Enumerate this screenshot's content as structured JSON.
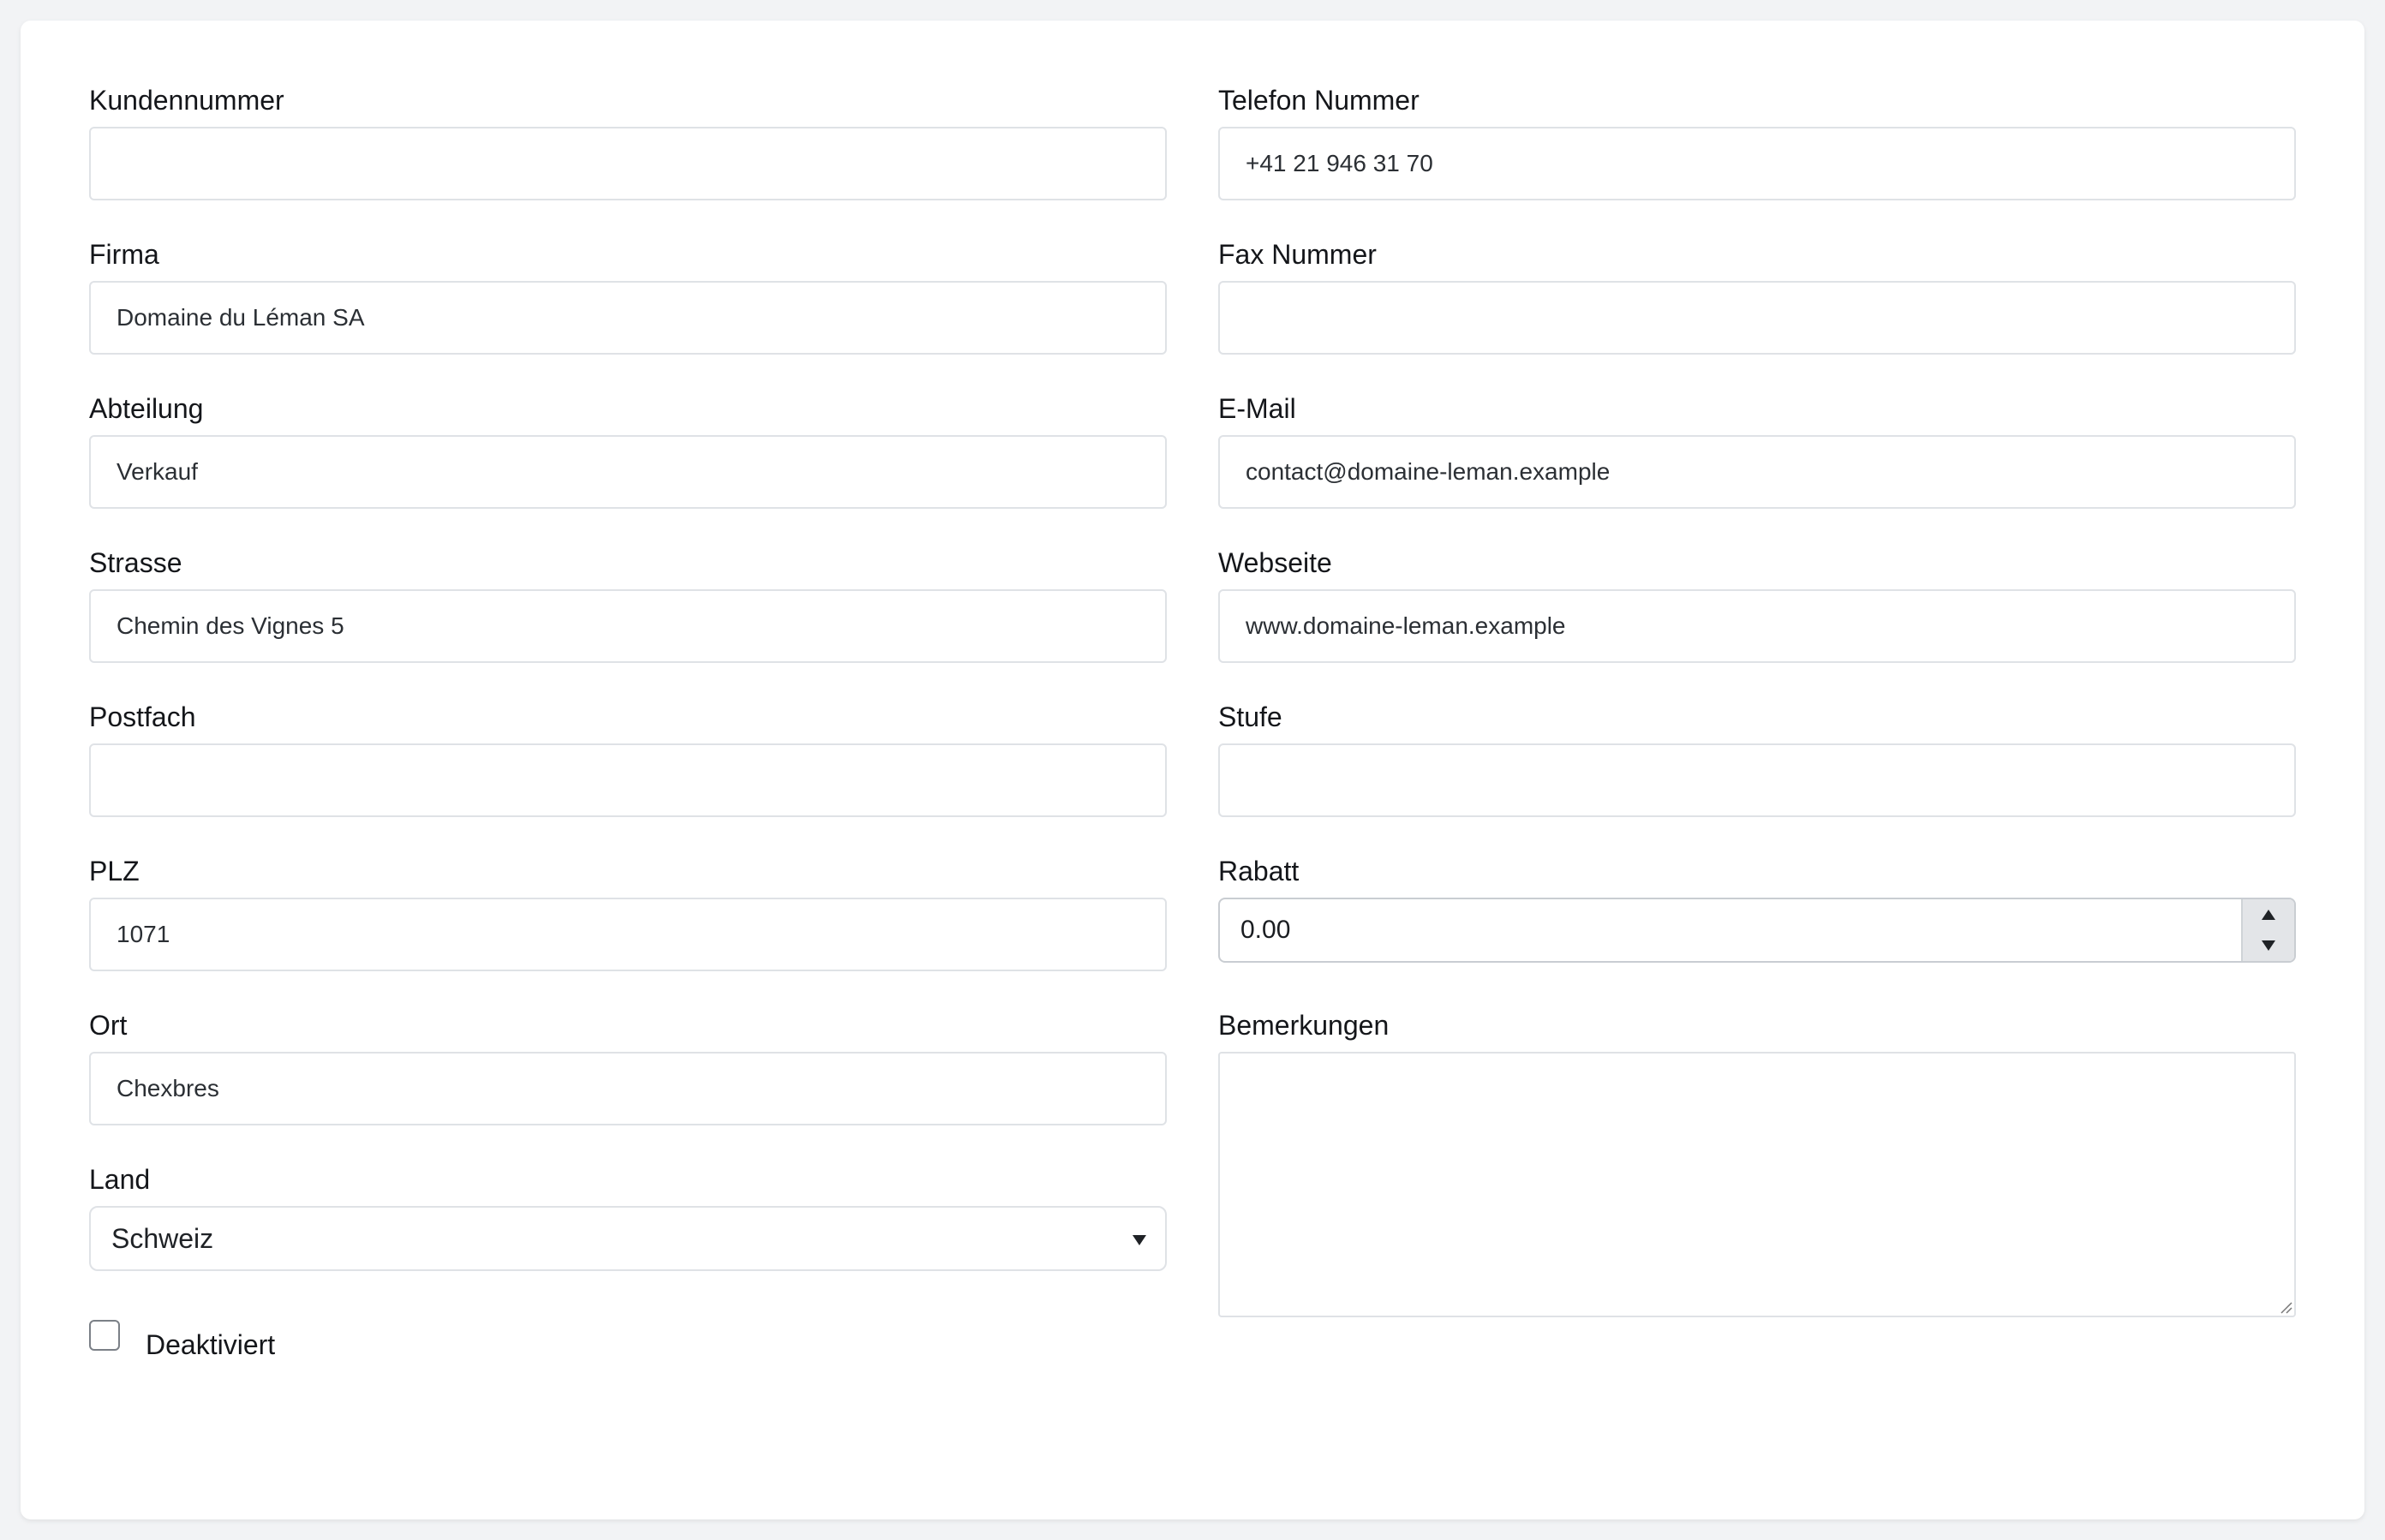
{
  "form": {
    "left": {
      "kundennummer": {
        "label": "Kundennummer",
        "value": ""
      },
      "firma": {
        "label": "Firma",
        "value": "Domaine du Léman SA"
      },
      "abteilung": {
        "label": "Abteilung",
        "value": "Verkauf"
      },
      "strasse": {
        "label": "Strasse",
        "value": "Chemin des Vignes 5"
      },
      "postfach": {
        "label": "Postfach",
        "value": ""
      },
      "plz": {
        "label": "PLZ",
        "value": "1071"
      },
      "ort": {
        "label": "Ort",
        "value": "Chexbres"
      },
      "land": {
        "label": "Land",
        "value": "Schweiz"
      },
      "deaktiviert": {
        "label": "Deaktiviert",
        "checked": false
      }
    },
    "right": {
      "telefon": {
        "label": "Telefon Nummer",
        "value": "+41 21 946 31 70"
      },
      "fax": {
        "label": "Fax Nummer",
        "value": ""
      },
      "email": {
        "label": "E-Mail",
        "value": "contact@domaine-leman.example"
      },
      "webseite": {
        "label": "Webseite",
        "value": "www.domaine-leman.example"
      },
      "stufe": {
        "label": "Stufe",
        "value": ""
      },
      "rabatt": {
        "label": "Rabatt",
        "value": "0.00"
      },
      "bemerkungen": {
        "label": "Bemerkungen",
        "value": ""
      }
    }
  },
  "icons": {
    "select_caret": "chevron-down-icon",
    "stepper_up": "triangle-up-icon",
    "stepper_down": "triangle-down-icon"
  },
  "colors": {
    "page_background": "#f2f3f5",
    "card_background": "#ffffff",
    "input_border": "#dfe2e6",
    "text": "#14161a"
  }
}
